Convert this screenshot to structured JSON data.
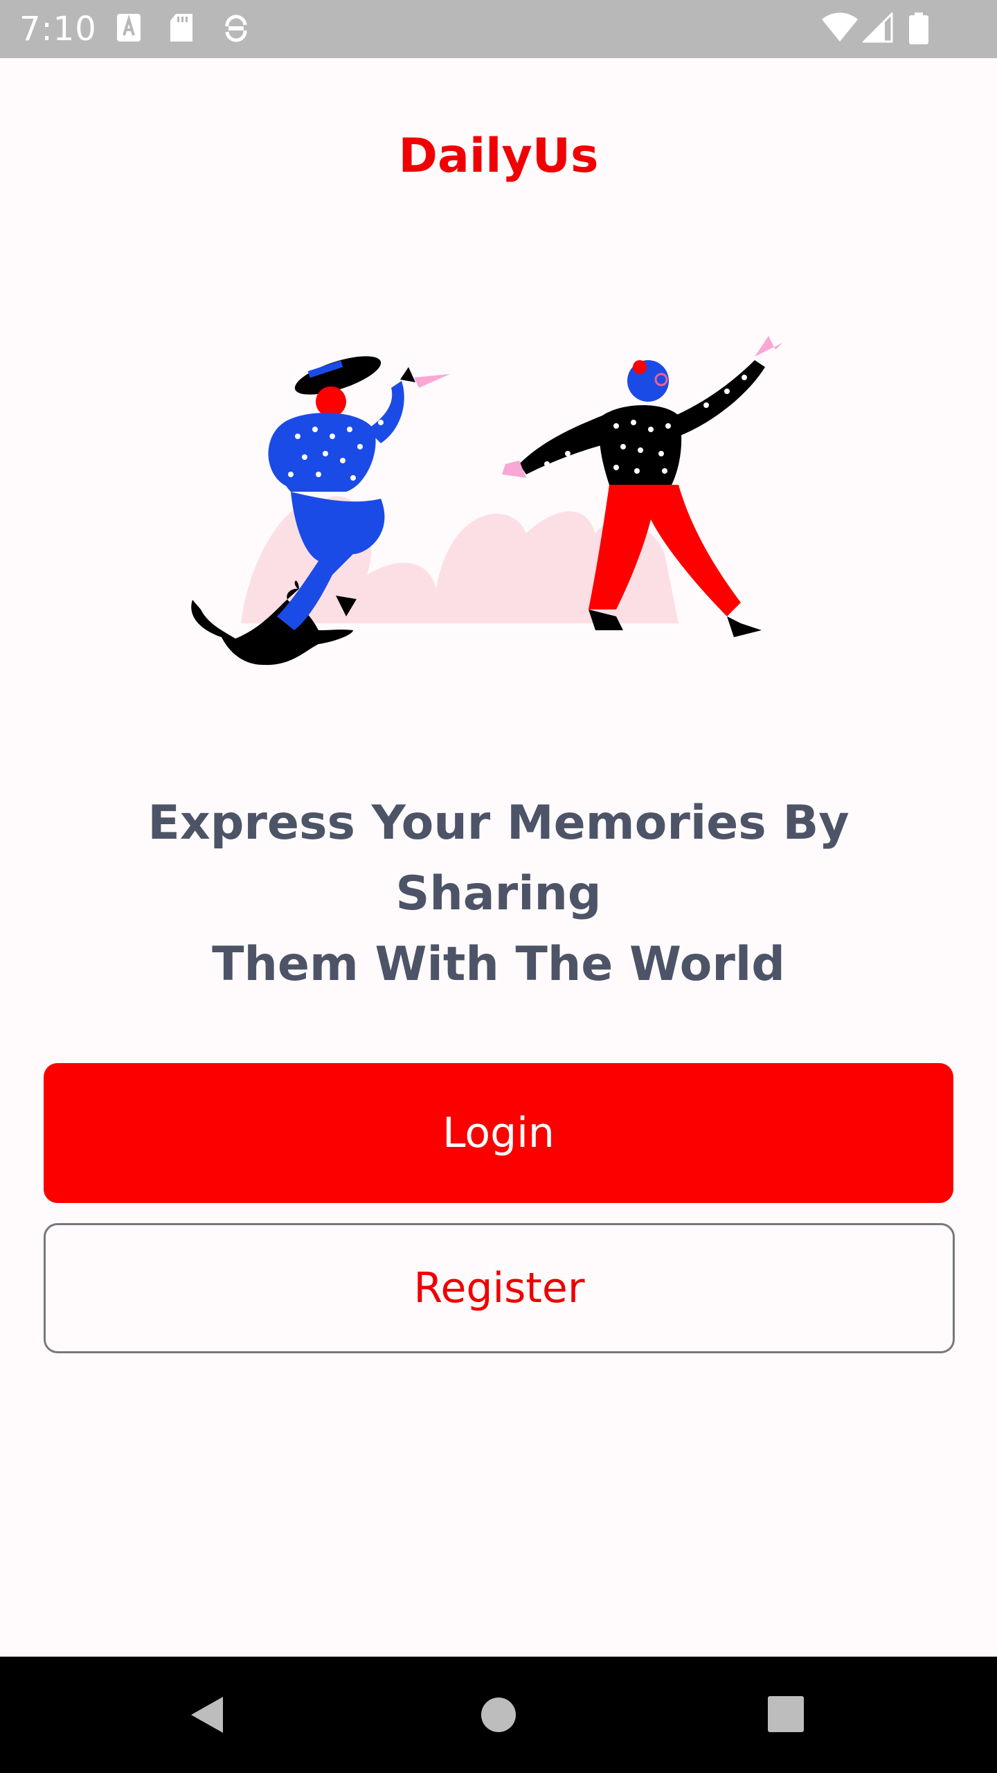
{
  "status_bar": {
    "time": "7:10",
    "left_icons": [
      "text-a-icon",
      "sd-card-icon",
      "sync-icon"
    ],
    "right_icons": [
      "wifi-icon",
      "cell-signal-icon",
      "battery-icon"
    ]
  },
  "app": {
    "title": "DailyUs",
    "brand_color": "#f00000"
  },
  "hero": {
    "illustration": "dancing-people-with-cat-illustration"
  },
  "tagline": {
    "line1": "Express Your Memories By Sharing",
    "line2": "Them With The World"
  },
  "actions": {
    "login_label": "Login",
    "register_label": "Register",
    "login_color": "#fc0000",
    "register_text_color": "#ee0000"
  },
  "nav_bar": {
    "buttons": [
      "back-icon",
      "home-icon",
      "recents-icon"
    ]
  }
}
